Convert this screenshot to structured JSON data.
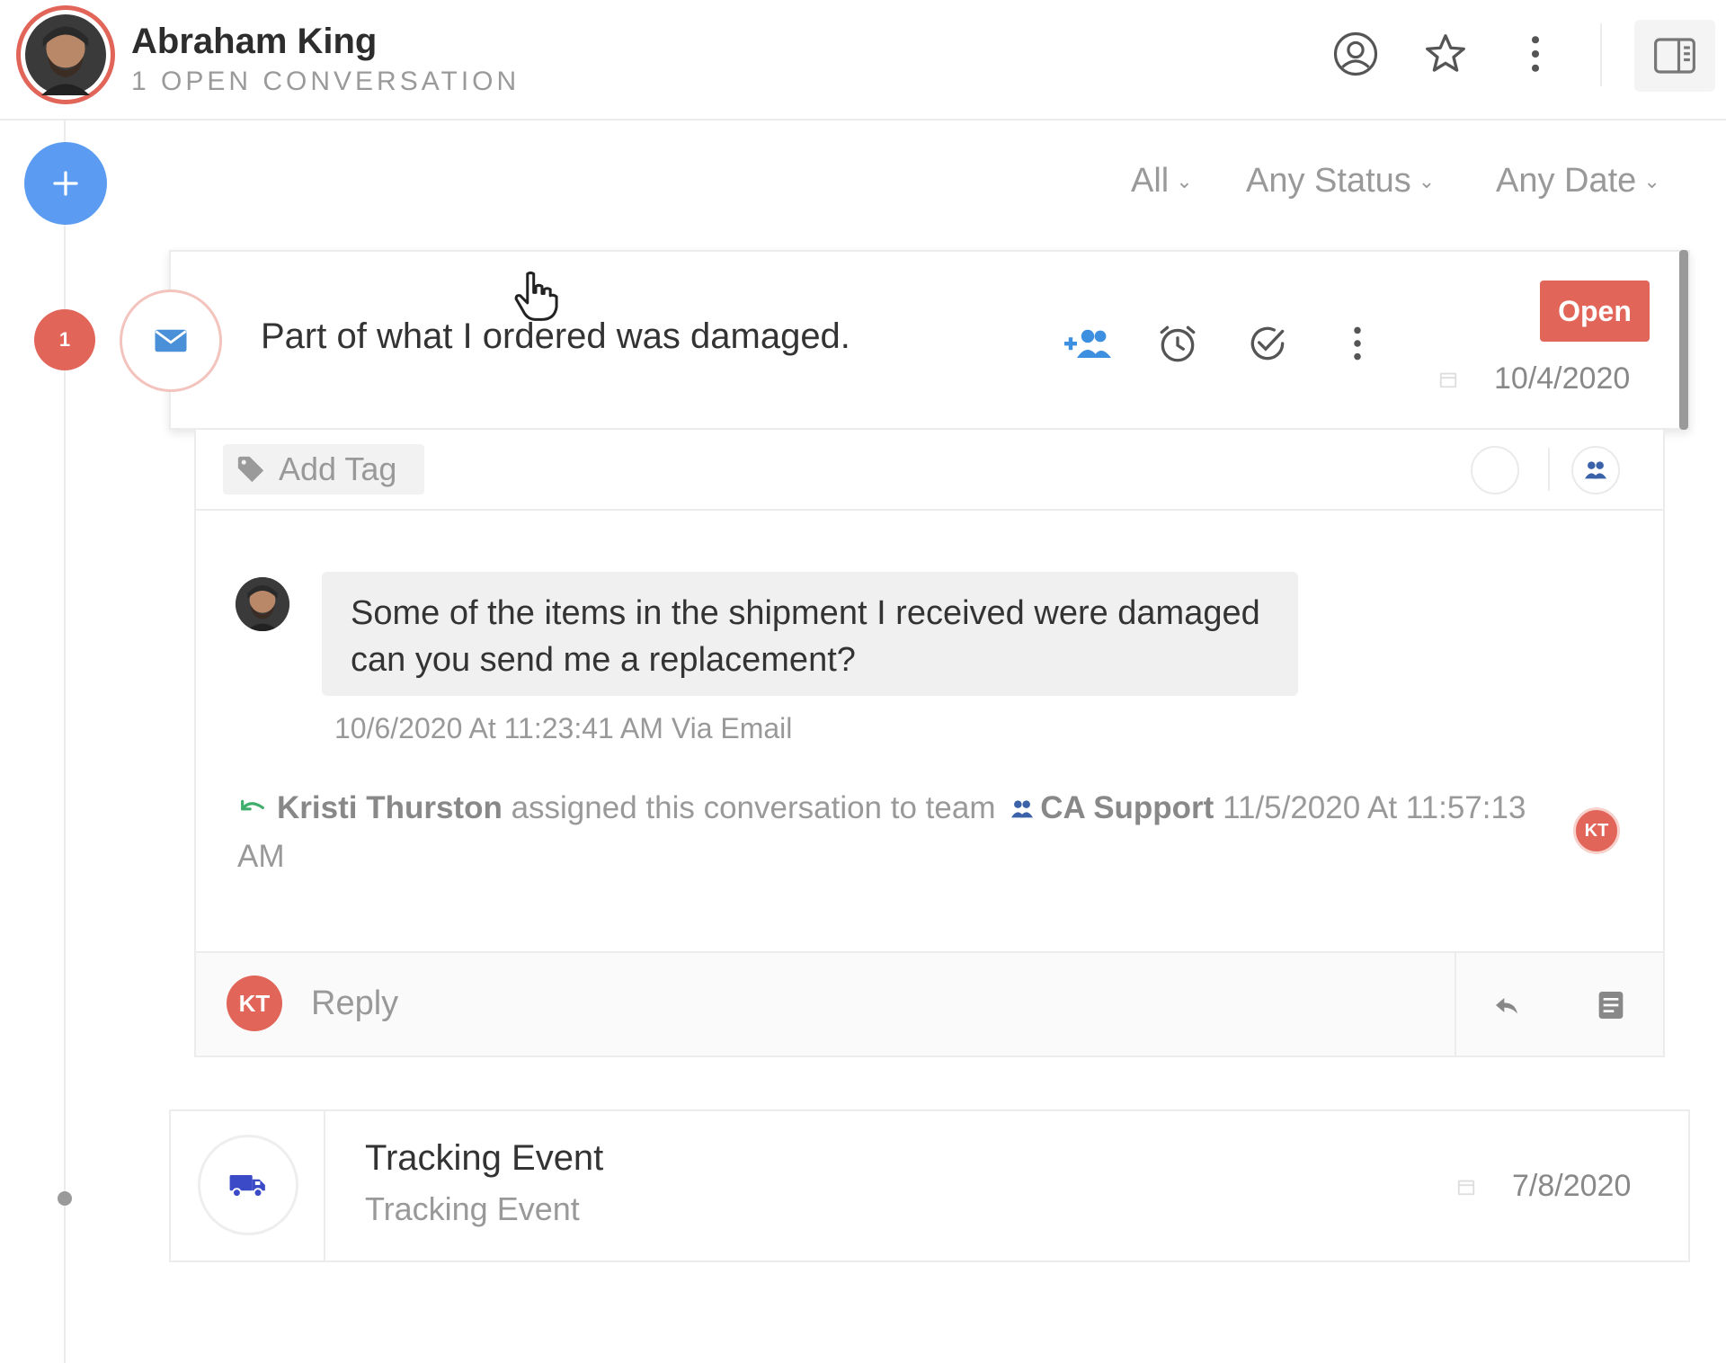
{
  "header": {
    "customer_name": "Abraham King",
    "open_count_label": "1 OPEN CONVERSATION"
  },
  "filters": {
    "channel": "All",
    "status": "Any Status",
    "date": "Any Date"
  },
  "timeline": {
    "open_count": "1"
  },
  "conversation": {
    "subject": "Part of what I ordered was damaged.",
    "status": "Open",
    "date": "10/4/2020",
    "add_tag_label": "Add Tag",
    "message": {
      "body": "Some of the items in the shipment I received were damaged can you send me a replacement?",
      "meta": "10/6/2020 At 11:23:41 AM Via Email"
    },
    "activity": {
      "actor": "Kristi Thurston",
      "action": "assigned this conversation to team",
      "team": "CA Support",
      "timestamp": "11/5/2020 At 11:57:13 AM",
      "actor_initials": "KT"
    },
    "reply": {
      "initials": "KT",
      "placeholder": "Reply"
    }
  },
  "tracking": {
    "title": "Tracking Event",
    "subtitle": "Tracking Event",
    "date": "7/8/2020"
  },
  "colors": {
    "accent_blue": "#5b9cf2",
    "status_red": "#e2655a",
    "truck_blue": "#3b4bc8"
  },
  "icons": [
    "user-circle-icon",
    "star-icon",
    "more-vertical-icon",
    "panel-toggle-icon",
    "plus-icon",
    "mail-icon",
    "add-team-icon",
    "alarm-clock-icon",
    "check-circle-icon",
    "calendar-icon",
    "tag-icon",
    "team-icon",
    "reassign-icon",
    "reply-icon",
    "note-icon",
    "truck-icon"
  ]
}
